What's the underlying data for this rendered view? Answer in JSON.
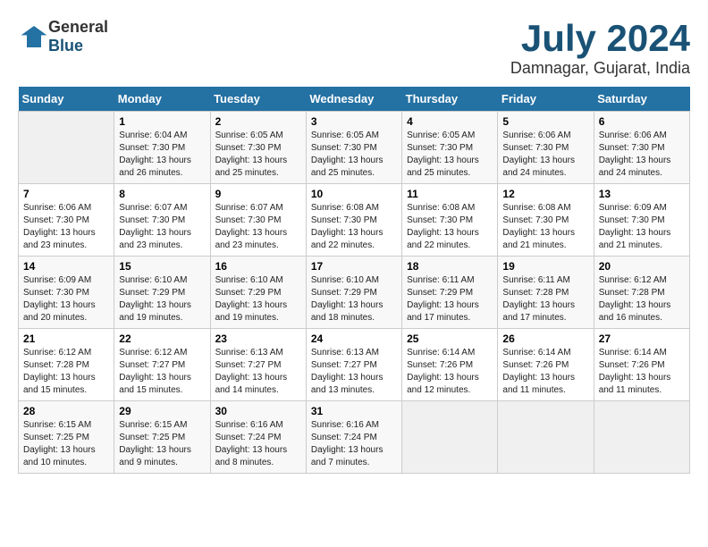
{
  "header": {
    "logo_general": "General",
    "logo_blue": "Blue",
    "month_title": "July 2024",
    "location": "Damnagar, Gujarat, India"
  },
  "days_of_week": [
    "Sunday",
    "Monday",
    "Tuesday",
    "Wednesday",
    "Thursday",
    "Friday",
    "Saturday"
  ],
  "weeks": [
    [
      {
        "day": "",
        "info": ""
      },
      {
        "day": "1",
        "info": "Sunrise: 6:04 AM\nSunset: 7:30 PM\nDaylight: 13 hours\nand 26 minutes."
      },
      {
        "day": "2",
        "info": "Sunrise: 6:05 AM\nSunset: 7:30 PM\nDaylight: 13 hours\nand 25 minutes."
      },
      {
        "day": "3",
        "info": "Sunrise: 6:05 AM\nSunset: 7:30 PM\nDaylight: 13 hours\nand 25 minutes."
      },
      {
        "day": "4",
        "info": "Sunrise: 6:05 AM\nSunset: 7:30 PM\nDaylight: 13 hours\nand 25 minutes."
      },
      {
        "day": "5",
        "info": "Sunrise: 6:06 AM\nSunset: 7:30 PM\nDaylight: 13 hours\nand 24 minutes."
      },
      {
        "day": "6",
        "info": "Sunrise: 6:06 AM\nSunset: 7:30 PM\nDaylight: 13 hours\nand 24 minutes."
      }
    ],
    [
      {
        "day": "7",
        "info": "Sunrise: 6:06 AM\nSunset: 7:30 PM\nDaylight: 13 hours\nand 23 minutes."
      },
      {
        "day": "8",
        "info": "Sunrise: 6:07 AM\nSunset: 7:30 PM\nDaylight: 13 hours\nand 23 minutes."
      },
      {
        "day": "9",
        "info": "Sunrise: 6:07 AM\nSunset: 7:30 PM\nDaylight: 13 hours\nand 23 minutes."
      },
      {
        "day": "10",
        "info": "Sunrise: 6:08 AM\nSunset: 7:30 PM\nDaylight: 13 hours\nand 22 minutes."
      },
      {
        "day": "11",
        "info": "Sunrise: 6:08 AM\nSunset: 7:30 PM\nDaylight: 13 hours\nand 22 minutes."
      },
      {
        "day": "12",
        "info": "Sunrise: 6:08 AM\nSunset: 7:30 PM\nDaylight: 13 hours\nand 21 minutes."
      },
      {
        "day": "13",
        "info": "Sunrise: 6:09 AM\nSunset: 7:30 PM\nDaylight: 13 hours\nand 21 minutes."
      }
    ],
    [
      {
        "day": "14",
        "info": "Sunrise: 6:09 AM\nSunset: 7:30 PM\nDaylight: 13 hours\nand 20 minutes."
      },
      {
        "day": "15",
        "info": "Sunrise: 6:10 AM\nSunset: 7:29 PM\nDaylight: 13 hours\nand 19 minutes."
      },
      {
        "day": "16",
        "info": "Sunrise: 6:10 AM\nSunset: 7:29 PM\nDaylight: 13 hours\nand 19 minutes."
      },
      {
        "day": "17",
        "info": "Sunrise: 6:10 AM\nSunset: 7:29 PM\nDaylight: 13 hours\nand 18 minutes."
      },
      {
        "day": "18",
        "info": "Sunrise: 6:11 AM\nSunset: 7:29 PM\nDaylight: 13 hours\nand 17 minutes."
      },
      {
        "day": "19",
        "info": "Sunrise: 6:11 AM\nSunset: 7:28 PM\nDaylight: 13 hours\nand 17 minutes."
      },
      {
        "day": "20",
        "info": "Sunrise: 6:12 AM\nSunset: 7:28 PM\nDaylight: 13 hours\nand 16 minutes."
      }
    ],
    [
      {
        "day": "21",
        "info": "Sunrise: 6:12 AM\nSunset: 7:28 PM\nDaylight: 13 hours\nand 15 minutes."
      },
      {
        "day": "22",
        "info": "Sunrise: 6:12 AM\nSunset: 7:27 PM\nDaylight: 13 hours\nand 15 minutes."
      },
      {
        "day": "23",
        "info": "Sunrise: 6:13 AM\nSunset: 7:27 PM\nDaylight: 13 hours\nand 14 minutes."
      },
      {
        "day": "24",
        "info": "Sunrise: 6:13 AM\nSunset: 7:27 PM\nDaylight: 13 hours\nand 13 minutes."
      },
      {
        "day": "25",
        "info": "Sunrise: 6:14 AM\nSunset: 7:26 PM\nDaylight: 13 hours\nand 12 minutes."
      },
      {
        "day": "26",
        "info": "Sunrise: 6:14 AM\nSunset: 7:26 PM\nDaylight: 13 hours\nand 11 minutes."
      },
      {
        "day": "27",
        "info": "Sunrise: 6:14 AM\nSunset: 7:26 PM\nDaylight: 13 hours\nand 11 minutes."
      }
    ],
    [
      {
        "day": "28",
        "info": "Sunrise: 6:15 AM\nSunset: 7:25 PM\nDaylight: 13 hours\nand 10 minutes."
      },
      {
        "day": "29",
        "info": "Sunrise: 6:15 AM\nSunset: 7:25 PM\nDaylight: 13 hours\nand 9 minutes."
      },
      {
        "day": "30",
        "info": "Sunrise: 6:16 AM\nSunset: 7:24 PM\nDaylight: 13 hours\nand 8 minutes."
      },
      {
        "day": "31",
        "info": "Sunrise: 6:16 AM\nSunset: 7:24 PM\nDaylight: 13 hours\nand 7 minutes."
      },
      {
        "day": "",
        "info": ""
      },
      {
        "day": "",
        "info": ""
      },
      {
        "day": "",
        "info": ""
      }
    ]
  ]
}
